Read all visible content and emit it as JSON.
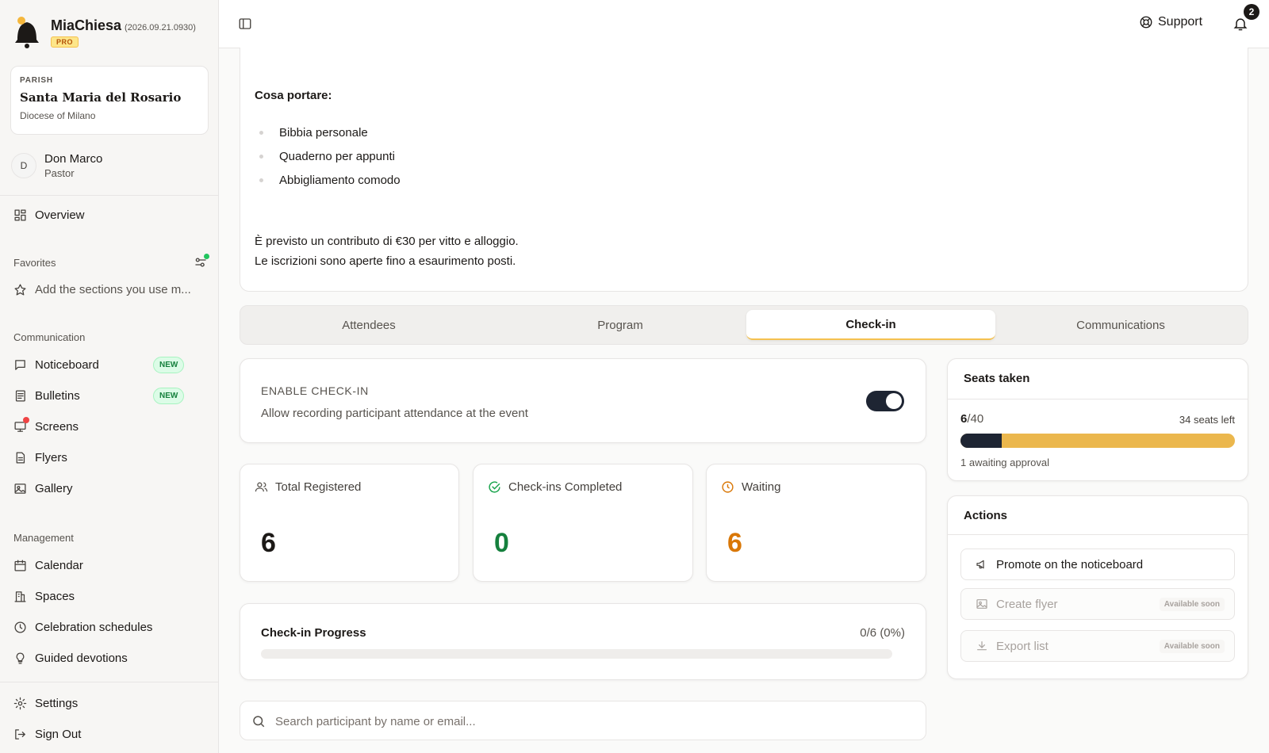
{
  "brand": {
    "name": "MiaChiesa",
    "version": "(2026.09.21.0930)",
    "tier": "PRO"
  },
  "parish": {
    "label": "PARISH",
    "name": "Santa Maria del Rosario",
    "diocese": "Diocese of Milano"
  },
  "user": {
    "initial": "D",
    "name": "Don Marco",
    "role": "Pastor"
  },
  "nav": {
    "overview": "Overview",
    "favorites_label": "Favorites",
    "favorites_hint": "Add the sections you use m...",
    "communication_label": "Communication",
    "noticeboard": "Noticeboard",
    "bulletins": "Bulletins",
    "screens": "Screens",
    "flyers": "Flyers",
    "gallery": "Gallery",
    "new_badge": "NEW",
    "management_label": "Management",
    "calendar": "Calendar",
    "spaces": "Spaces",
    "celebration_schedules": "Celebration schedules",
    "guided_devotions": "Guided devotions",
    "settings": "Settings",
    "sign_out": "Sign Out"
  },
  "header": {
    "support": "Support",
    "notification_count": "2"
  },
  "description": {
    "heading": "Cosa portare:",
    "items": [
      "Bibbia personale",
      "Quaderno per appunti",
      "Abbigliamento comodo"
    ],
    "paragraph1": "È previsto un contributo di €30 per vitto e alloggio.",
    "paragraph2": "Le iscrizioni sono aperte fino a esaurimento posti."
  },
  "tabs": [
    "Attendees",
    "Program",
    "Check-in",
    "Communications"
  ],
  "active_tab": "Check-in",
  "checkin": {
    "title": "ENABLE CHECK-IN",
    "description": "Allow recording participant attendance at the event",
    "enabled": true
  },
  "stats": {
    "total_label": "Total Registered",
    "total_value": "6",
    "completed_label": "Check-ins Completed",
    "completed_value": "0",
    "waiting_label": "Waiting",
    "waiting_value": "6"
  },
  "progress": {
    "title": "Check-in Progress",
    "count": "0/6 (0%)",
    "fraction": 0
  },
  "search": {
    "placeholder": "Search participant by name or email..."
  },
  "seats": {
    "title": "Seats taken",
    "taken": "6",
    "total": "/40",
    "left": "34 seats left",
    "fraction": 0.15,
    "note": "1 awaiting approval"
  },
  "actions": {
    "title": "Actions",
    "promote": "Promote on the noticeboard",
    "flyer": "Create flyer",
    "export": "Export list",
    "soon": "Available soon"
  },
  "colors": {
    "accent": "#ebb74d",
    "dark": "#1e2533",
    "success": "#15803d",
    "warning": "#d97706"
  }
}
